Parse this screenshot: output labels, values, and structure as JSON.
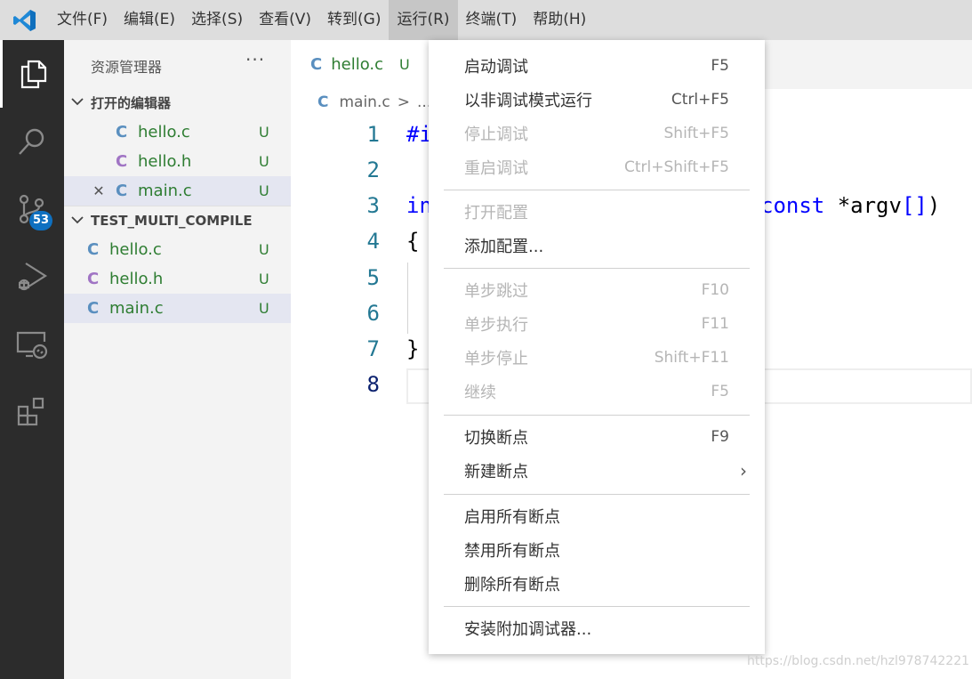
{
  "menubar": {
    "items": [
      "文件(F)",
      "编辑(E)",
      "选择(S)",
      "查看(V)",
      "转到(G)",
      "运行(R)",
      "终端(T)",
      "帮助(H)"
    ]
  },
  "activity": {
    "scm_badge": "53"
  },
  "sidebar": {
    "title": "资源管理器",
    "more": "···",
    "open_editors": {
      "header": "打开的编辑器",
      "files": [
        {
          "icon": "C",
          "name": "hello.c",
          "status": "U"
        },
        {
          "icon": "C",
          "name": "hello.h",
          "status": "U"
        },
        {
          "icon": "C",
          "name": "main.c",
          "status": "U",
          "close": "✕"
        }
      ]
    },
    "folder": {
      "header": "TEST_MULTI_COMPILE",
      "files": [
        {
          "icon": "C",
          "name": "hello.c",
          "status": "U"
        },
        {
          "icon": "C",
          "name": "hello.h",
          "status": "U"
        },
        {
          "icon": "C",
          "name": "main.c",
          "status": "U"
        }
      ]
    }
  },
  "editor": {
    "tab": {
      "icon": "C",
      "name": "hello.c",
      "status": "U"
    },
    "breadcrumb": {
      "icon": "C",
      "file": "main.c",
      "sep": ">",
      "rest": "..."
    },
    "lines": [
      "1",
      "2",
      "3",
      "4",
      "5",
      "6",
      "7",
      "8"
    ],
    "code": {
      "l1": "#i",
      "l3_a": "in",
      "l3_kw": "const",
      "l3_b": " *argv",
      "l3_br": "[]",
      "l3_c": ")",
      "l4": "{",
      "l7": "}"
    }
  },
  "run_menu": {
    "items": [
      {
        "label": "启动调试",
        "key": "F5",
        "enabled": true
      },
      {
        "label": "以非调试模式运行",
        "key": "Ctrl+F5",
        "enabled": true
      },
      {
        "label": "停止调试",
        "key": "Shift+F5",
        "enabled": false
      },
      {
        "label": "重启调试",
        "key": "Ctrl+Shift+F5",
        "enabled": false
      },
      {
        "label": "打开配置",
        "key": "",
        "enabled": false
      },
      {
        "label": "添加配置...",
        "key": "",
        "enabled": true
      },
      {
        "label": "单步跳过",
        "key": "F10",
        "enabled": false
      },
      {
        "label": "单步执行",
        "key": "F11",
        "enabled": false
      },
      {
        "label": "单步停止",
        "key": "Shift+F11",
        "enabled": false
      },
      {
        "label": "继续",
        "key": "F5",
        "enabled": false
      },
      {
        "label": "切换断点",
        "key": "F9",
        "enabled": true
      },
      {
        "label": "新建断点",
        "key": "",
        "enabled": true,
        "submenu": "›"
      },
      {
        "label": "启用所有断点",
        "key": "",
        "enabled": true
      },
      {
        "label": "禁用所有断点",
        "key": "",
        "enabled": true
      },
      {
        "label": "删除所有断点",
        "key": "",
        "enabled": true
      },
      {
        "label": "安装附加调试器...",
        "key": "",
        "enabled": true
      }
    ]
  },
  "watermark": "https://blog.csdn.net/hzl978742221"
}
